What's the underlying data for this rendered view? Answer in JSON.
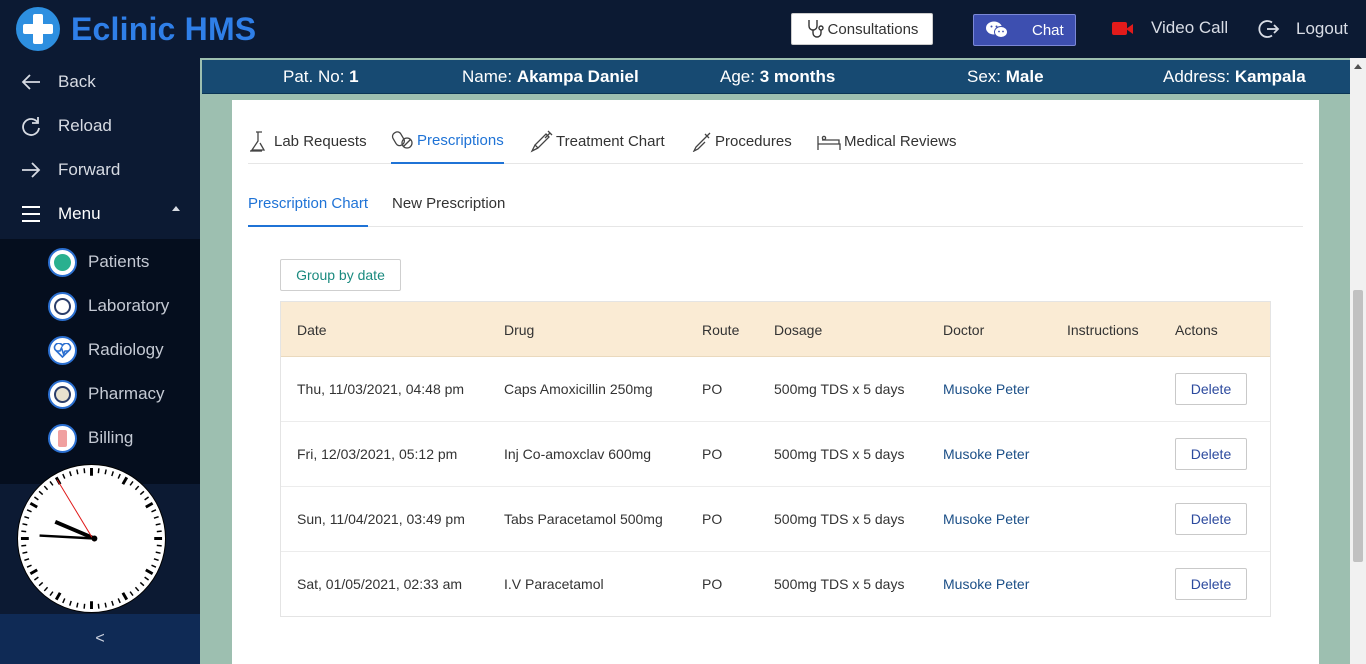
{
  "app": {
    "title": "Eclinic HMS"
  },
  "header": {
    "consultations_label": "Consultations",
    "chat_label": "Chat",
    "video_call_label": "Video Call",
    "logout_label": "Logout"
  },
  "sidebar": {
    "nav": [
      {
        "label": "Back",
        "icon": "arrow-left-icon"
      },
      {
        "label": "Reload",
        "icon": "reload-icon"
      },
      {
        "label": "Forward",
        "icon": "arrow-right-icon"
      },
      {
        "label": "Menu",
        "icon": "hamburger-icon"
      }
    ],
    "submenu": [
      {
        "label": "Patients",
        "icon": "patients-icon"
      },
      {
        "label": "Laboratory",
        "icon": "laboratory-icon"
      },
      {
        "label": "Radiology",
        "icon": "radiology-icon"
      },
      {
        "label": "Pharmacy",
        "icon": "pharmacy-icon"
      },
      {
        "label": "Billing",
        "icon": "billing-icon"
      }
    ],
    "collapse_label": "<"
  },
  "patient": {
    "no_label": "Pat. No:",
    "no_value": "1",
    "name_label": "Name:",
    "name_value": "Akampa Daniel",
    "age_label": "Age:",
    "age_value": "3 months",
    "sex_label": "Sex:",
    "sex_value": "Male",
    "address_label": "Address:",
    "address_value": "Kampala"
  },
  "tabs": [
    {
      "label": "Lab Requests",
      "icon": "lab-request-icon"
    },
    {
      "label": "Prescriptions",
      "icon": "prescriptions-icon"
    },
    {
      "label": "Treatment Chart",
      "icon": "syringe-icon"
    },
    {
      "label": "Procedures",
      "icon": "procedures-icon"
    },
    {
      "label": "Medical Reviews",
      "icon": "hospital-bed-icon"
    }
  ],
  "subtabs": [
    {
      "label": "Prescription Chart"
    },
    {
      "label": "New Prescription"
    }
  ],
  "group_button_label": "Group by date",
  "table": {
    "headers": [
      "Date",
      "Drug",
      "Route",
      "Dosage",
      "Doctor",
      "Instructions",
      "Actons"
    ],
    "rows": [
      {
        "date": "Thu, 11/03/2021, 04:48 pm",
        "drug": "Caps Amoxicillin 250mg",
        "route": "PO",
        "dosage": "500mg TDS x 5 days",
        "doctor": "Musoke Peter",
        "instructions": "",
        "action": "Delete"
      },
      {
        "date": "Fri, 12/03/2021, 05:12 pm",
        "drug": "Inj Co-amoxclav 600mg",
        "route": "PO",
        "dosage": "500mg TDS x 5 days",
        "doctor": "Musoke Peter",
        "instructions": "",
        "action": "Delete"
      },
      {
        "date": "Sun, 11/04/2021, 03:49 pm",
        "drug": "Tabs Paracetamol 500mg",
        "route": "PO",
        "dosage": "500mg TDS x 5 days",
        "doctor": "Musoke Peter",
        "instructions": "",
        "action": "Delete"
      },
      {
        "date": "Sat, 01/05/2021, 02:33 am",
        "drug": "I.V Paracetamol",
        "route": "PO",
        "dosage": "500mg TDS x 5 days",
        "doctor": "Musoke Peter",
        "instructions": "",
        "action": "Delete"
      }
    ]
  },
  "colors": {
    "topbar": "#0c1a33",
    "brand": "#2f7fe8",
    "accent": "#1f73d6",
    "patient_bar": "#174a72",
    "table_header": "#faebd4",
    "page_bg": "#9dbfb0"
  }
}
